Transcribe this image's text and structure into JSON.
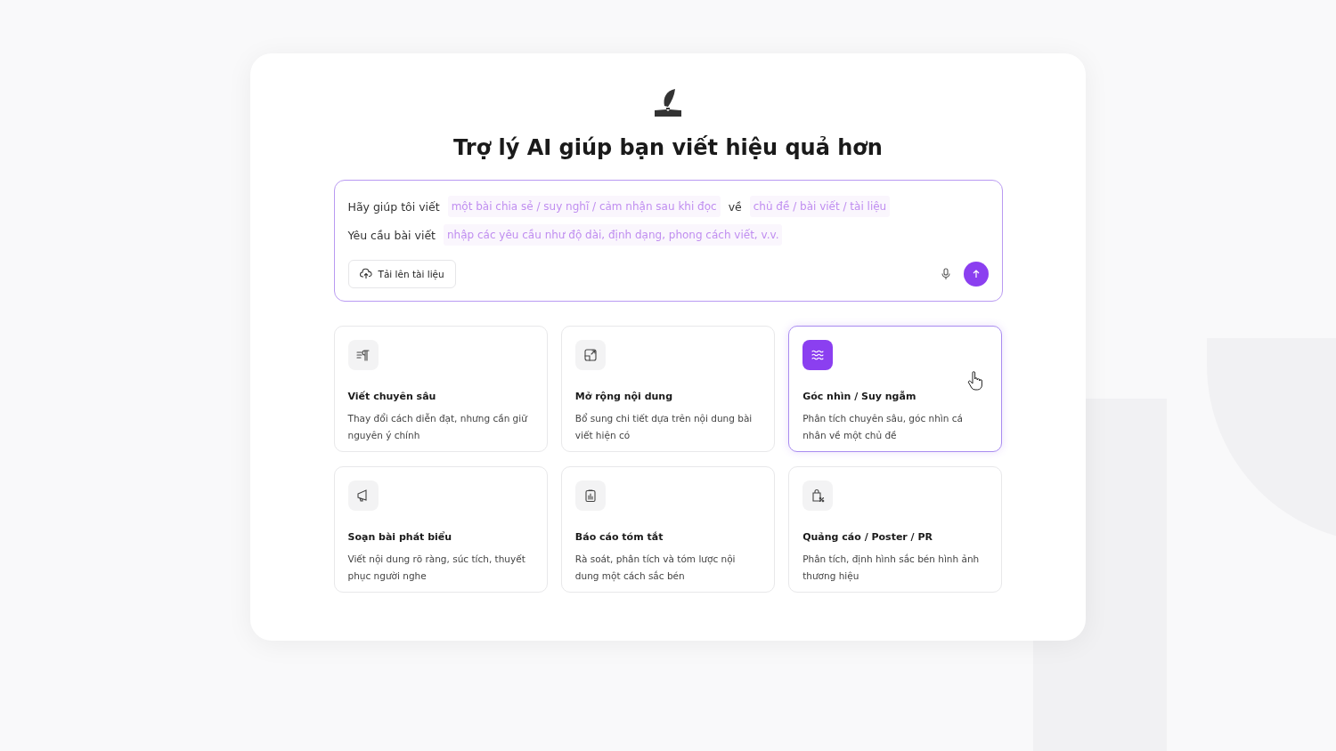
{
  "header": {
    "title": "Trợ lý AI giúp bạn viết hiệu quả hơn"
  },
  "prompt": {
    "rows": [
      {
        "parts": [
          {
            "kind": "label",
            "text": "Hãy giúp tôi viết"
          },
          {
            "kind": "slot",
            "text": "một bài chia sẻ / suy nghĩ / cảm nhận sau khi đọc"
          },
          {
            "kind": "label",
            "text": "về"
          },
          {
            "kind": "slot",
            "text": "chủ đề / bài viết / tài liệu"
          }
        ]
      },
      {
        "parts": [
          {
            "kind": "label",
            "text": "Yêu cầu bài viết"
          },
          {
            "kind": "slot",
            "text": "nhập các yêu cầu như độ dài, định dạng, phong cách viết, v.v."
          }
        ]
      }
    ],
    "upload_button": "Tải lên tài liệu"
  },
  "cards": [
    {
      "kind": "paragraph",
      "title": "Viết chuyên sâu",
      "description": "Thay đổi cách diễn đạt, nhưng cần giữ nguyên ý chính",
      "selected": false
    },
    {
      "kind": "expand",
      "title": "Mở rộng nội dung",
      "description": "Bổ sung chi tiết dựa trên nội dung bài viết hiện có",
      "selected": false
    },
    {
      "kind": "waves",
      "title": "Góc nhìn / Suy ngẫm",
      "description": "Phân tích chuyên sâu, góc nhìn cá nhân về một chủ đề",
      "selected": true
    },
    {
      "kind": "megaphone",
      "title": "Soạn bài phát biểu",
      "description": "Viết nội dung rõ ràng, súc tích, thuyết phục người nghe",
      "selected": false
    },
    {
      "kind": "clipboard",
      "title": "Báo cáo tóm tắt",
      "description": "Rà soát, phân tích và tóm lược nội dung một cách sắc bén",
      "selected": false
    },
    {
      "kind": "bag",
      "title": "Quảng cáo / Poster / PR",
      "description": "Phân tích, định hình sắc bén hình ảnh thương hiệu",
      "selected": false
    }
  ]
}
